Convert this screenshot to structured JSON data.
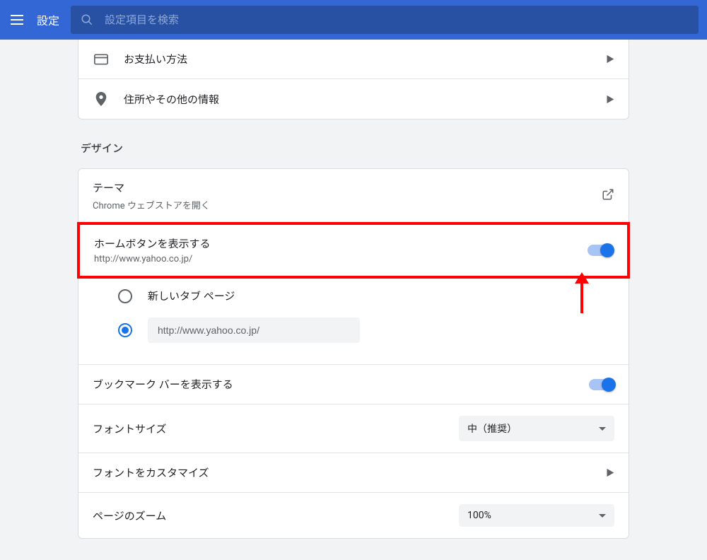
{
  "header": {
    "title": "設定",
    "search_placeholder": "設定項目を検索"
  },
  "autofill": {
    "payment_label": "お支払い方法",
    "address_label": "住所やその他の情報"
  },
  "design": {
    "heading": "デザイン",
    "theme": {
      "label": "テーマ",
      "sub": "Chrome ウェブストアを開く"
    },
    "home_button": {
      "label": "ホームボタンを表示する",
      "sub": "http://www.yahoo.co.jp/",
      "enabled": true,
      "options": {
        "new_tab": "新しいタブ ページ",
        "custom_url": "http://www.yahoo.co.jp/"
      }
    },
    "bookmark_bar": {
      "label": "ブックマーク バーを表示する",
      "enabled": true
    },
    "font_size": {
      "label": "フォントサイズ",
      "value": "中（推奨）"
    },
    "font_customize": {
      "label": "フォントをカスタマイズ"
    },
    "page_zoom": {
      "label": "ページのズーム",
      "value": "100%"
    }
  }
}
